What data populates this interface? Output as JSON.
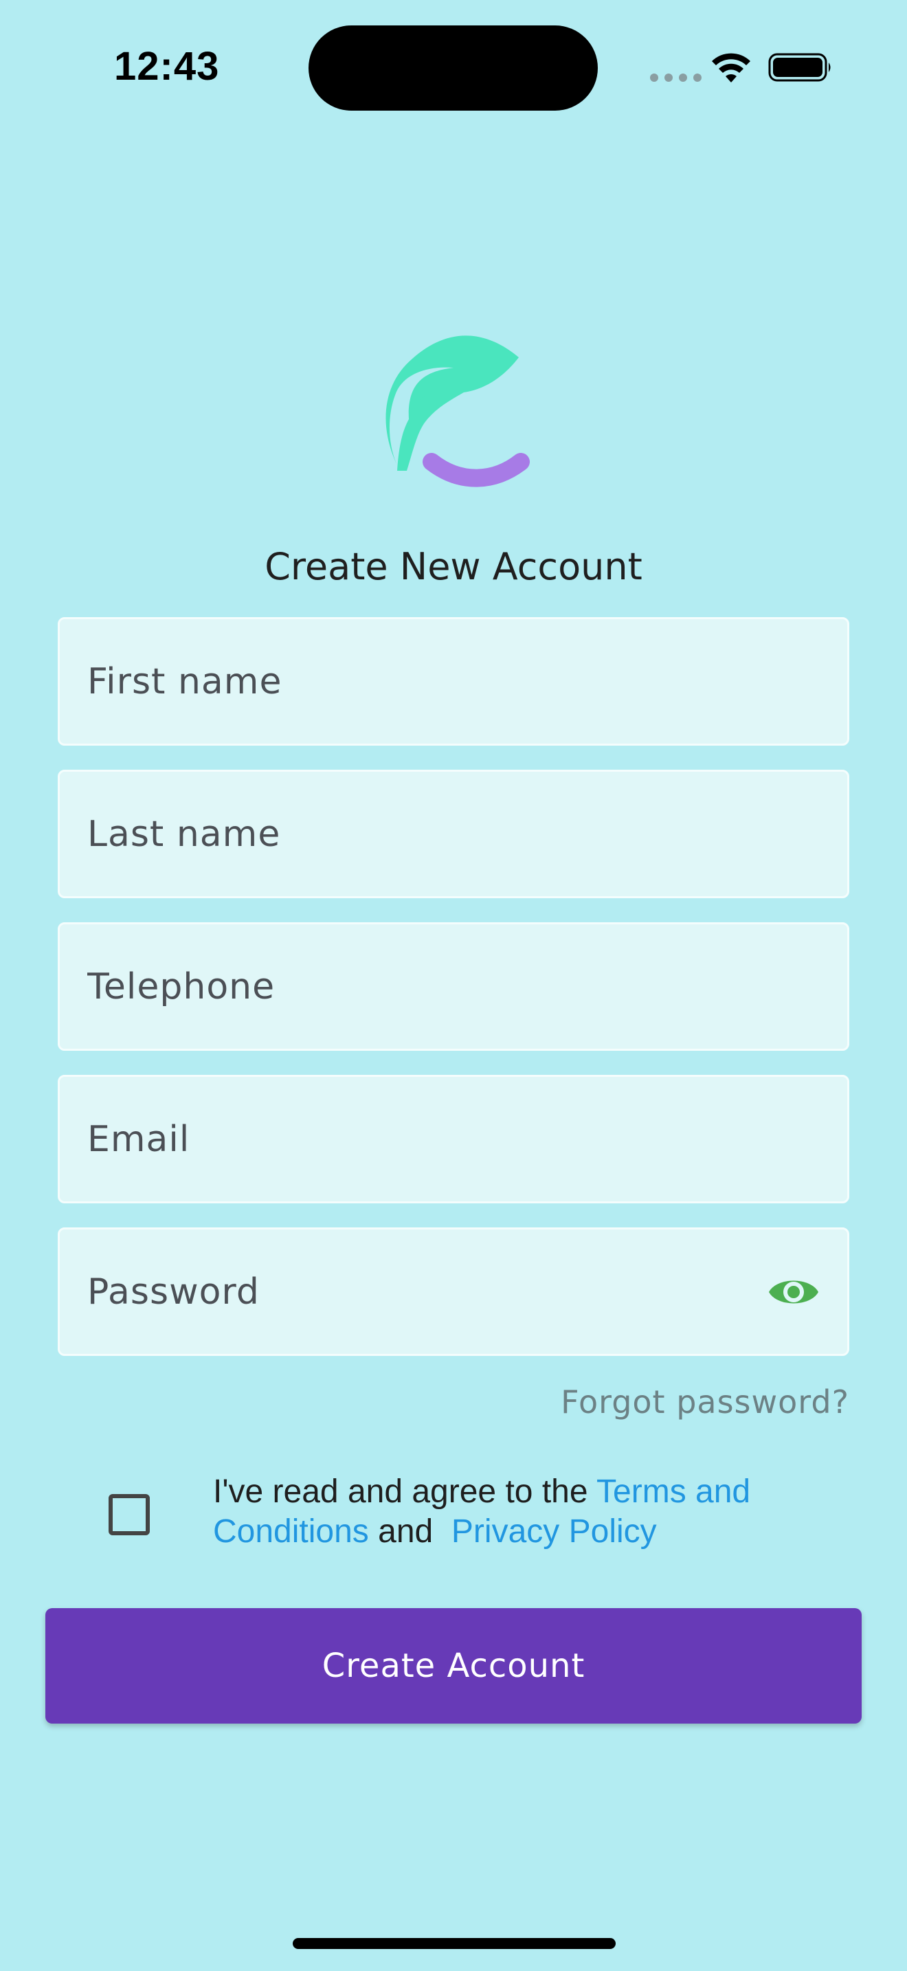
{
  "status_bar": {
    "time": "12:43"
  },
  "brand": {
    "logo_icon": "leaf-e-logo-icon",
    "primary_color": "#4AE5BE",
    "secondary_color": "#A77BE6"
  },
  "page": {
    "title": "Create New Account"
  },
  "form": {
    "first_name_placeholder": "First name",
    "last_name_placeholder": "Last name",
    "telephone_placeholder": "Telephone",
    "email_placeholder": "Email",
    "password_placeholder": "Password",
    "password_toggle_icon": "eye-icon",
    "forgot_password": "Forgot password?"
  },
  "terms": {
    "prefix": "I've read and agree to the ",
    "terms_link": "Terms and Conditions",
    "joiner": " and  ",
    "privacy_link": "Privacy Policy",
    "link_color": "#2196E0"
  },
  "actions": {
    "create_account": "Create Account",
    "button_color": "#673AB7"
  }
}
